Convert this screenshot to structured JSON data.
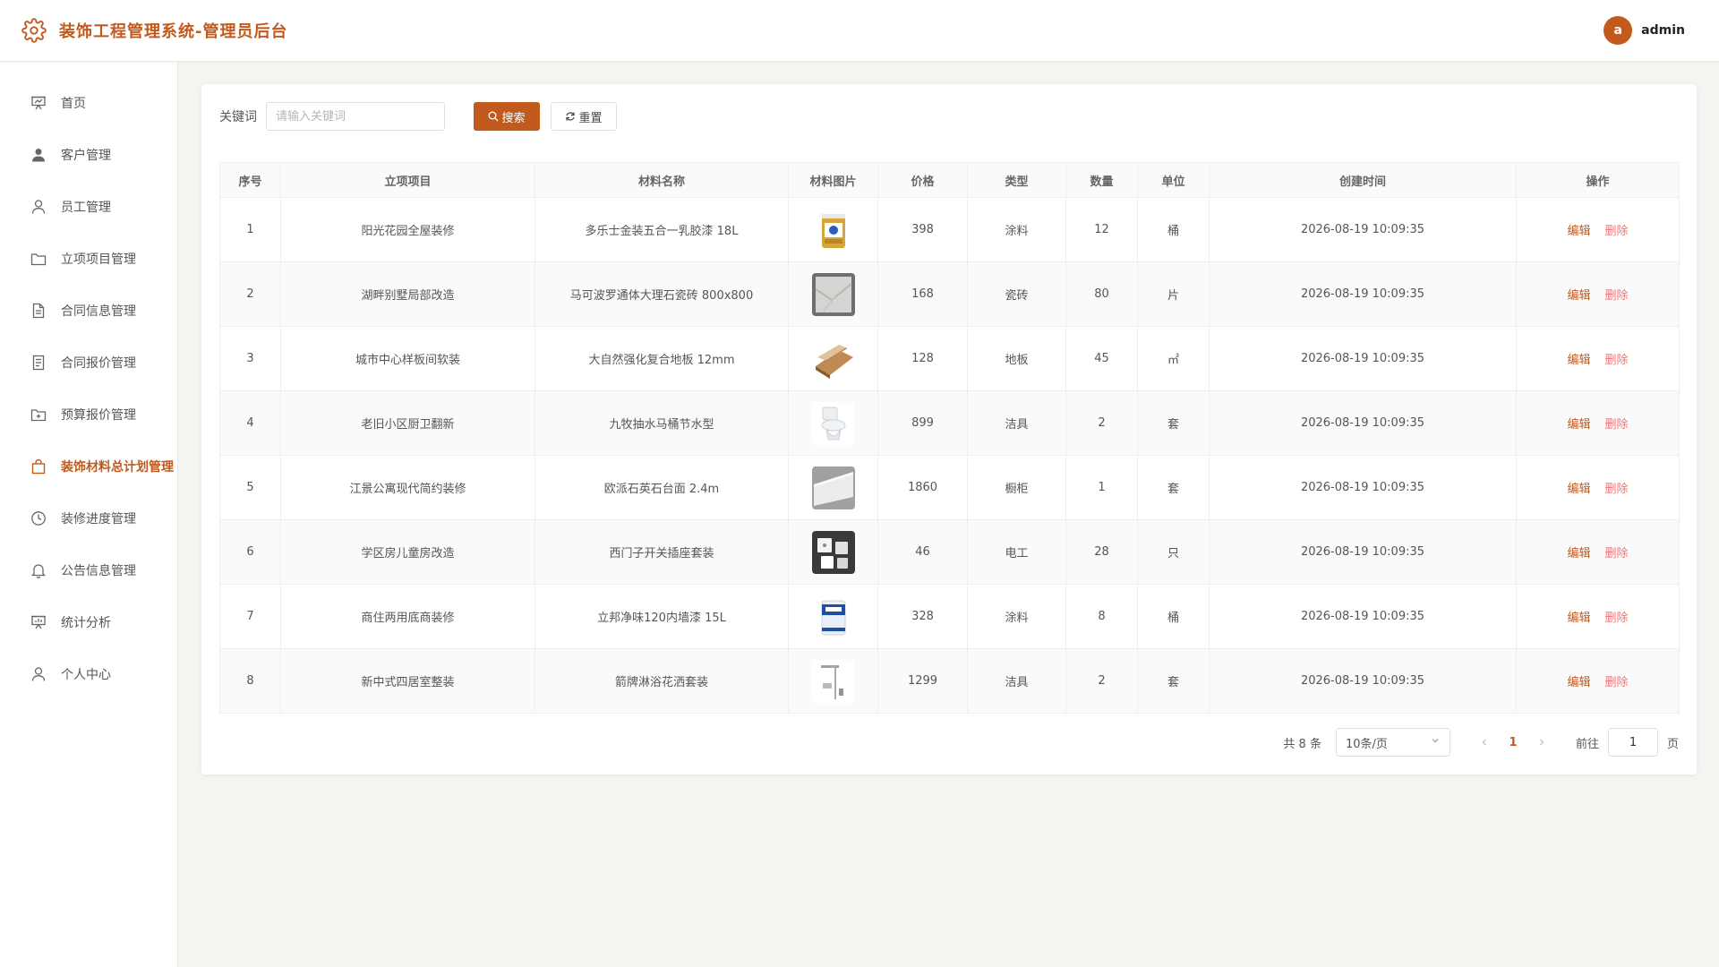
{
  "header": {
    "title": "装饰工程管理系统-管理员后台",
    "avatar_letter": "a",
    "username": "admin"
  },
  "colors": {
    "accent": "#c25a1d",
    "delete": "#f07474"
  },
  "sidebar": {
    "items": [
      {
        "label": "首页",
        "icon": "presentation-icon"
      },
      {
        "label": "客户管理",
        "icon": "user-solid-icon"
      },
      {
        "label": "员工管理",
        "icon": "user-icon"
      },
      {
        "label": "立项项目管理",
        "icon": "folder-icon"
      },
      {
        "label": "合同信息管理",
        "icon": "document-icon"
      },
      {
        "label": "合同报价管理",
        "icon": "document-list-icon"
      },
      {
        "label": "预算报价管理",
        "icon": "folder-add-icon"
      },
      {
        "label": "装饰材料总计划管理",
        "icon": "shopping-bag-icon",
        "active": true
      },
      {
        "label": "装修进度管理",
        "icon": "clock-icon"
      },
      {
        "label": "公告信息管理",
        "icon": "bell-icon"
      },
      {
        "label": "统计分析",
        "icon": "chart-board-icon"
      },
      {
        "label": "个人中心",
        "icon": "user-icon"
      }
    ]
  },
  "search": {
    "label": "关键词",
    "placeholder": "请输入关键词",
    "value": "",
    "search_label": "搜索",
    "reset_label": "重置"
  },
  "table": {
    "columns": [
      "序号",
      "立项项目",
      "材料名称",
      "材料图片",
      "价格",
      "类型",
      "数量",
      "单位",
      "创建时间",
      "操作"
    ],
    "edit_label": "编辑",
    "delete_label": "删除",
    "rows": [
      {
        "no": "1",
        "project": "阳光花园全屋装修",
        "material": "多乐士金装五合一乳胶漆 18L",
        "image": "paint-bucket-gold",
        "price": "398",
        "type": "涂料",
        "qty": "12",
        "unit": "桶",
        "created": "2026-08-19 10:09:35"
      },
      {
        "no": "2",
        "project": "湖畔别墅局部改造",
        "material": "马可波罗通体大理石瓷砖 800x800",
        "image": "marble-tile",
        "price": "168",
        "type": "瓷砖",
        "qty": "80",
        "unit": "片",
        "created": "2026-08-19 10:09:35"
      },
      {
        "no": "3",
        "project": "城市中心样板间软装",
        "material": "大自然强化复合地板 12mm",
        "image": "wood-floor",
        "price": "128",
        "type": "地板",
        "qty": "45",
        "unit": "㎡",
        "created": "2026-08-19 10:09:35"
      },
      {
        "no": "4",
        "project": "老旧小区厨卫翻新",
        "material": "九牧抽水马桶节水型",
        "image": "toilet",
        "price": "899",
        "type": "洁具",
        "qty": "2",
        "unit": "套",
        "created": "2026-08-19 10:09:35"
      },
      {
        "no": "5",
        "project": "江景公寓现代简约装修",
        "material": "欧派石英石台面 2.4m",
        "image": "quartz-countertop",
        "price": "1860",
        "type": "橱柜",
        "qty": "1",
        "unit": "套",
        "created": "2026-08-19 10:09:35"
      },
      {
        "no": "6",
        "project": "学区房儿童房改造",
        "material": "西门子开关插座套装",
        "image": "switch-socket-set",
        "price": "46",
        "type": "电工",
        "qty": "28",
        "unit": "只",
        "created": "2026-08-19 10:09:35"
      },
      {
        "no": "7",
        "project": "商住两用底商装修",
        "material": "立邦净味120内墙漆 15L",
        "image": "paint-bucket-blue",
        "price": "328",
        "type": "涂料",
        "qty": "8",
        "unit": "桶",
        "created": "2026-08-19 10:09:35"
      },
      {
        "no": "8",
        "project": "新中式四居室整装",
        "material": "箭牌淋浴花洒套装",
        "image": "shower-set",
        "price": "1299",
        "type": "洁具",
        "qty": "2",
        "unit": "套",
        "created": "2026-08-19 10:09:35"
      }
    ]
  },
  "pagination": {
    "total_text": "共 8 条",
    "page_size": "10条/页",
    "current_page": "1",
    "goto_prefix": "前往",
    "goto_value": "1",
    "goto_suffix": "页"
  }
}
